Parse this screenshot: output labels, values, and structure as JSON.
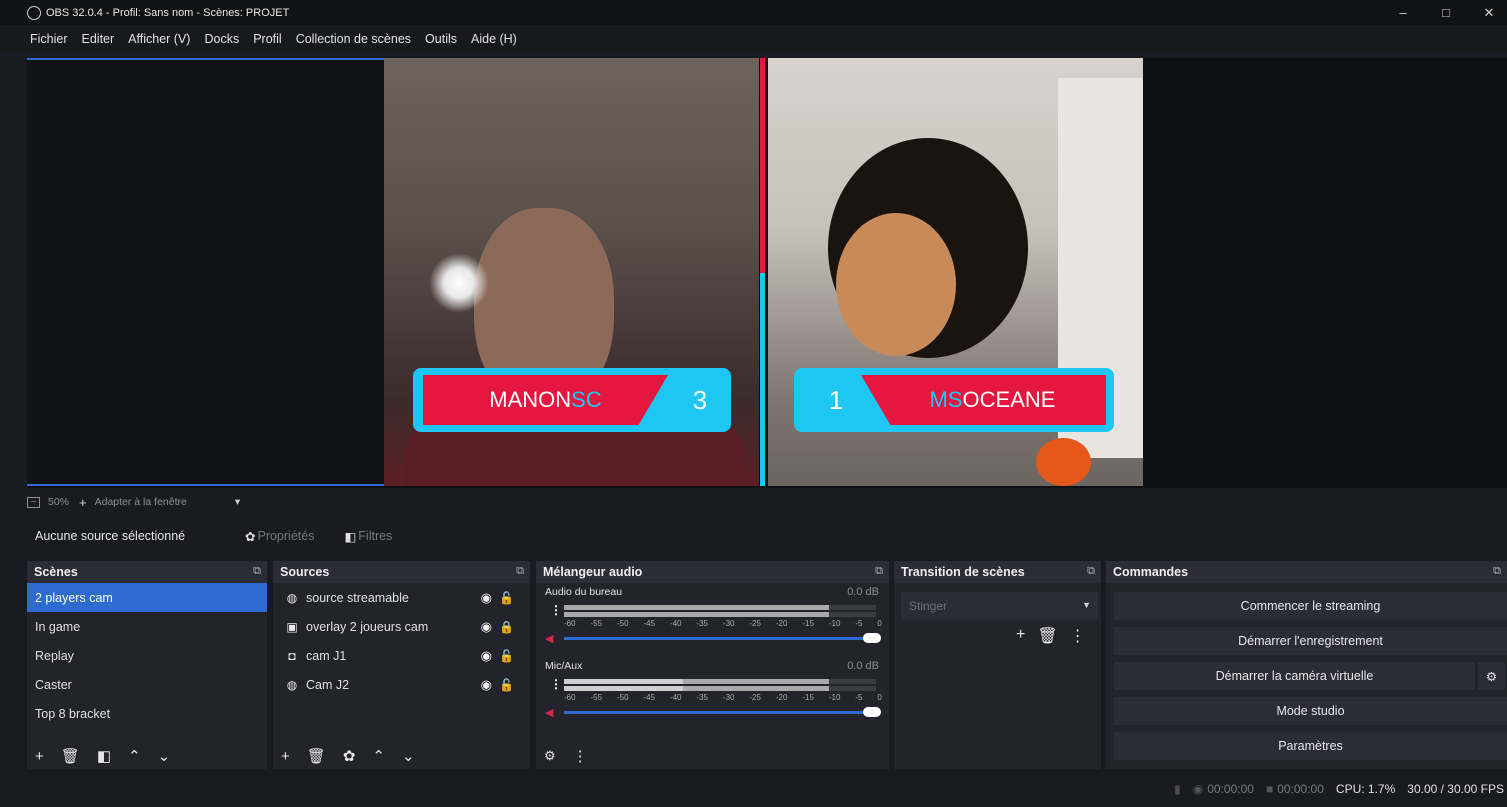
{
  "window": {
    "title": "OBS 32.0.4 - Profil: Sans nom - Scènes: PROJET",
    "controls": [
      "–",
      "□",
      "✕"
    ]
  },
  "menu": [
    "Fichier",
    "Editer",
    "Afficher (V)",
    "Docks",
    "Profil",
    "Collection de scènes",
    "Outils",
    "Aide (H)"
  ],
  "preview": {
    "player_left": {
      "name_prefix": "MANON",
      "name_suffix": "SC",
      "score": "3"
    },
    "player_right": {
      "score": "1",
      "name_prefix": "MS",
      "name_suffix": " OCEANE"
    }
  },
  "zoom": {
    "minus": "−",
    "level": "50%",
    "plus": "+",
    "fit": "Adapter à la fenêtre",
    "arrow": "▾"
  },
  "source_bar": {
    "none_selected": "Aucune source sélectionné",
    "properties": "Propriétés",
    "filters": "Filtres"
  },
  "scenes": {
    "header": "Scènes",
    "items": [
      "2 players cam",
      "In game",
      "Replay",
      "Caster",
      "Top 8 bracket"
    ],
    "selected": 0
  },
  "sources": {
    "header": "Sources",
    "items": [
      {
        "label": "source streamable",
        "icon": "globe-icon"
      },
      {
        "label": "overlay 2 joueurs cam",
        "icon": "image-icon"
      },
      {
        "label": "cam J1",
        "icon": "camera-icon"
      },
      {
        "label": "Cam J2",
        "icon": "globe-icon"
      }
    ]
  },
  "mixer": {
    "header": "Mélangeur audio",
    "channels": [
      {
        "name": "Audio du bureau",
        "db": "0.0 dB",
        "level": 0.96,
        "peak": 0.0
      },
      {
        "name": "Mic/Aux",
        "db": "0.0 dB",
        "level": 0.96,
        "peak": 0.4
      }
    ],
    "ticks": [
      "-60",
      "-55",
      "-50",
      "-45",
      "-40",
      "-35",
      "-30",
      "-25",
      "-20",
      "-15",
      "-10",
      "-5",
      "0"
    ]
  },
  "transitions": {
    "header": "Transition de scènes",
    "selected": "Stinger"
  },
  "commands": {
    "header": "Commandes",
    "buttons": [
      "Commencer le streaming",
      "Démarrer l'enregistrement",
      "Démarrer la caméra virtuelle",
      "Mode studio",
      "Paramètres"
    ]
  },
  "status": {
    "rec_time": "00:00:00",
    "stream_time": "00:00:00",
    "cpu": "CPU: 1.7%",
    "fps": "30.00 / 30.00 FPS"
  },
  "colors": {
    "accent_blue": "#2e6bd0",
    "cyan": "#1ec7f3",
    "red": "#e5163f"
  }
}
